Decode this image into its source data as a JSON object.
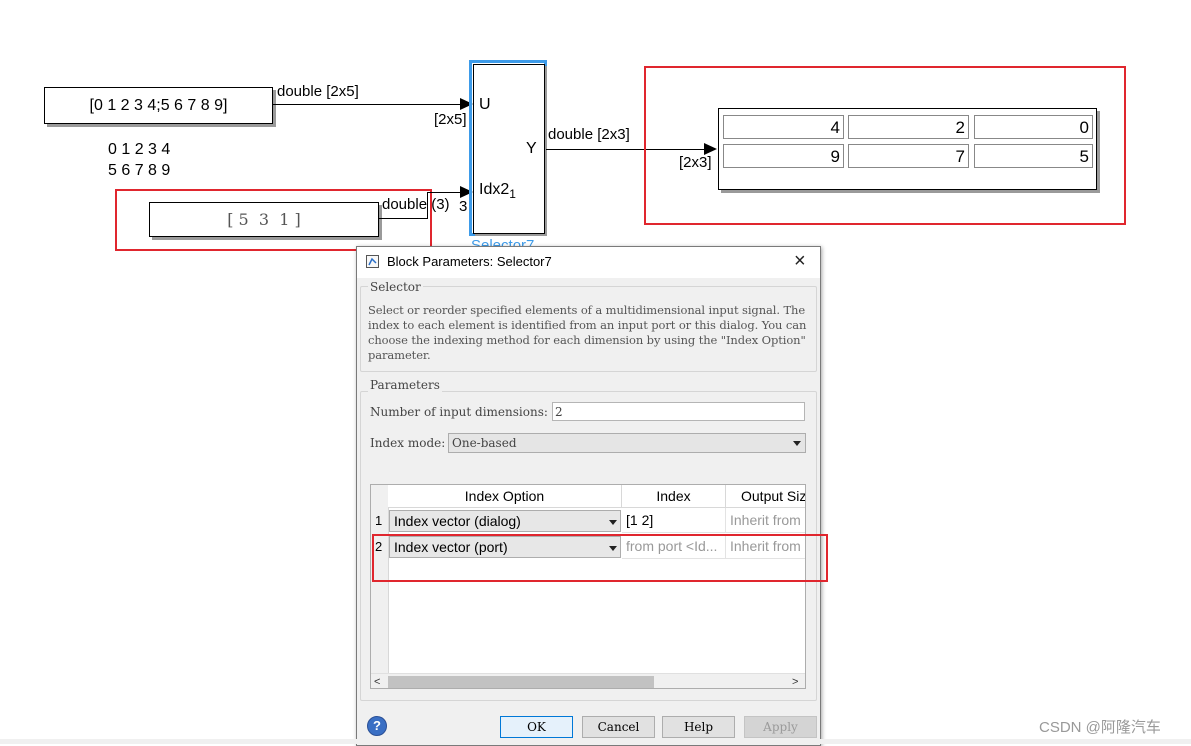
{
  "model": {
    "constant_block": {
      "value": "[0 1 2 3 4;5 6 7 8 9]"
    },
    "matrix_note": {
      "row1": "0 1 2 3 4",
      "row2": "5 6 7 8 9"
    },
    "index_block": {
      "value": "[ 5  3  1 ]"
    },
    "signals": {
      "const_out": "double [2x5]",
      "u_dim": "[2x5]",
      "idx_out": "double (3)",
      "idx_dim": "3",
      "y_out": "double [2x3]",
      "y_dim": "[2x3]"
    },
    "selector_block": {
      "port_u": "U",
      "port_y": "Y",
      "port_idx": "Idx2",
      "port_idx_sub": "1",
      "name": "Selector7"
    },
    "display_block": {
      "values": [
        [
          "4",
          "2",
          "0"
        ],
        [
          "9",
          "7",
          "5"
        ]
      ]
    }
  },
  "dialog": {
    "title": "Block Parameters: Selector7",
    "close": "×",
    "section_title": "Selector",
    "description": "Select or reorder specified elements of a multidimensional input signal. The index to each element is identified from an input port or this dialog. You can choose the indexing method for each dimension by using the \"Index Option\" parameter.",
    "params_title": "Parameters",
    "num_dims_label": "Number of input dimensions:",
    "num_dims_value": "2",
    "index_mode_label": "Index mode:",
    "index_mode_value": "One-based",
    "table": {
      "headers": [
        "Index Option",
        "Index",
        "Output Siz"
      ],
      "rows": [
        {
          "num": "1",
          "option": "Index vector (dialog)",
          "index": "[1 2]",
          "output": "Inherit from"
        },
        {
          "num": "2",
          "option": "Index vector (port)",
          "index": "from port <Id...",
          "output": "Inherit from"
        }
      ]
    },
    "buttons": {
      "ok": "OK",
      "cancel": "Cancel",
      "help": "Help",
      "apply": "Apply"
    },
    "help_icon": "?"
  },
  "watermark": "CSDN @阿隆汽车",
  "colors": {
    "highlight_red": "#e0262e",
    "selected_block_blue": "#3d9be9"
  },
  "icons": [
    "block-icon",
    "close-icon",
    "help-icon",
    "dropdown-arrow-icon",
    "scroll-left-icon",
    "scroll-right-icon"
  ]
}
